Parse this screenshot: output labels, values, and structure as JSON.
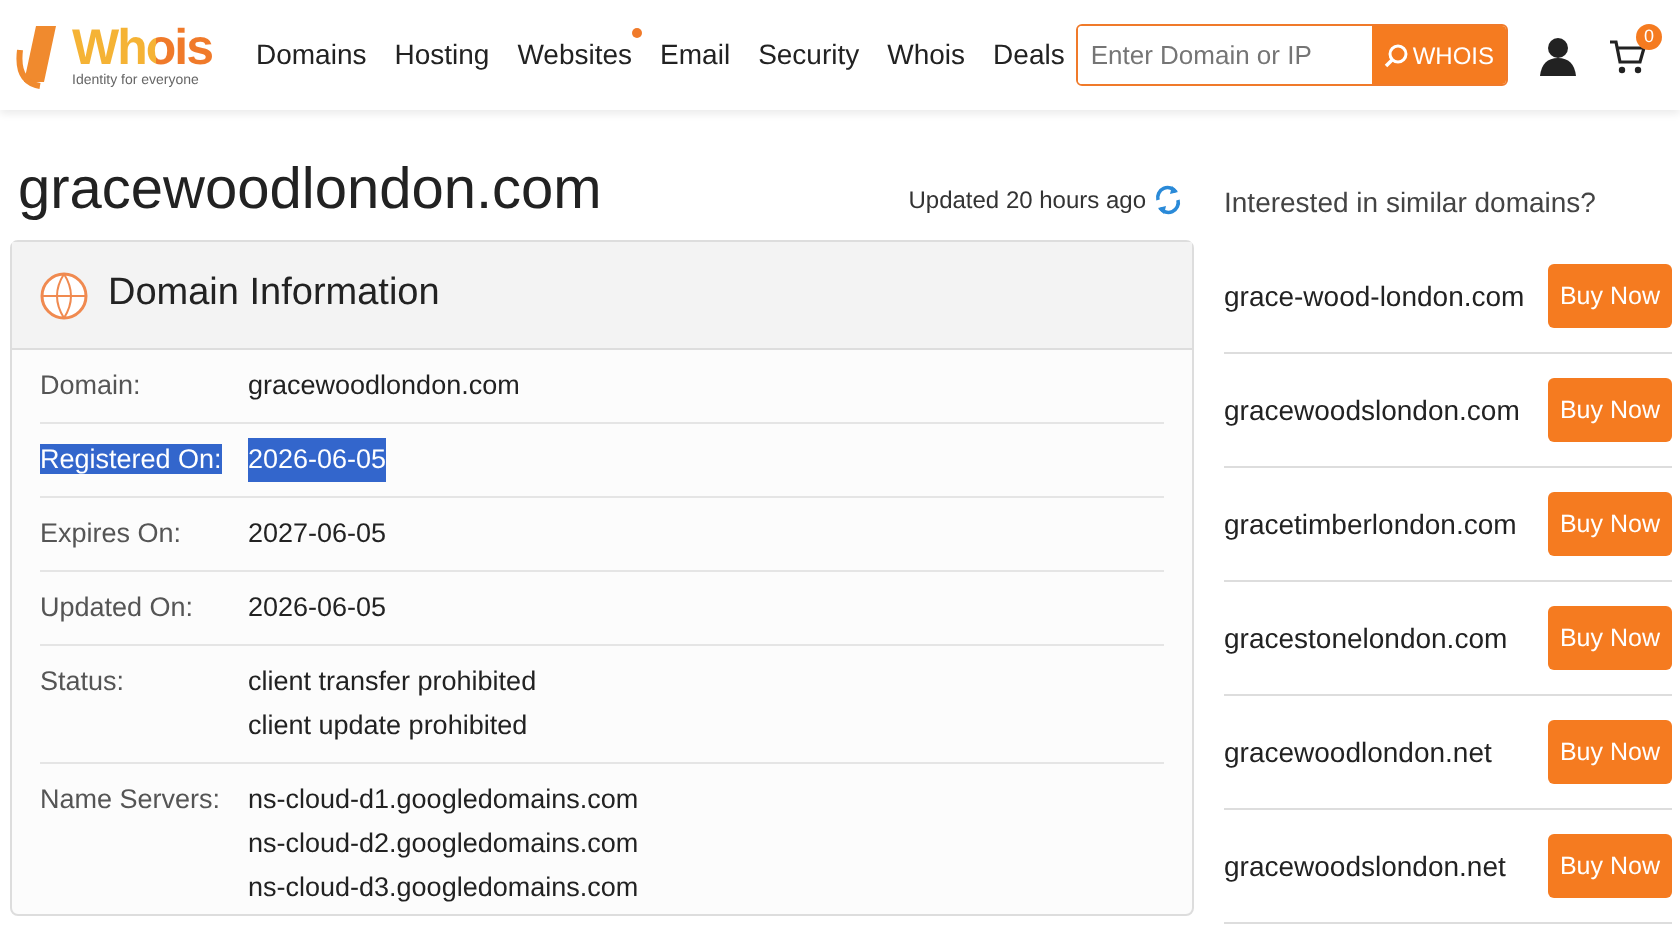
{
  "logo": {
    "name": "Whois",
    "tagline": "Identity for everyone"
  },
  "nav": [
    {
      "label": "Domains",
      "dot": false
    },
    {
      "label": "Hosting",
      "dot": false
    },
    {
      "label": "Websites",
      "dot": true
    },
    {
      "label": "Email",
      "dot": false
    },
    {
      "label": "Security",
      "dot": false
    },
    {
      "label": "Whois",
      "dot": false
    },
    {
      "label": "Deals",
      "dot": false
    }
  ],
  "search": {
    "placeholder": "Enter Domain or IP",
    "button": "WHOIS"
  },
  "cart_count": "0",
  "page_title": "gracewoodlondon.com",
  "updated": "Updated 20 hours ago",
  "card": {
    "title": "Domain Information",
    "rows": [
      {
        "label": "Domain:",
        "values": [
          "gracewoodlondon.com"
        ],
        "selected": false
      },
      {
        "label": "Registered On:",
        "values": [
          "2026-06-05"
        ],
        "selected": true
      },
      {
        "label": "Expires On:",
        "values": [
          "2027-06-05"
        ],
        "selected": false
      },
      {
        "label": "Updated On:",
        "values": [
          "2026-06-05"
        ],
        "selected": false
      },
      {
        "label": "Status:",
        "values": [
          "client transfer prohibited",
          "client update prohibited"
        ],
        "selected": false
      },
      {
        "label": "Name Servers:",
        "values": [
          "ns-cloud-d1.googledomains.com",
          "ns-cloud-d2.googledomains.com",
          "ns-cloud-d3.googledomains.com"
        ],
        "selected": false
      }
    ]
  },
  "similar": {
    "heading": "Interested in similar domains?",
    "items": [
      {
        "domain": "grace-wood-london.com",
        "button": "Buy Now"
      },
      {
        "domain": "gracewoodslondon.com",
        "button": "Buy Now"
      },
      {
        "domain": "gracetimberlondon.com",
        "button": "Buy Now"
      },
      {
        "domain": "gracestonelondon.com",
        "button": "Buy Now"
      },
      {
        "domain": "gracewoodlondon.net",
        "button": "Buy Now"
      },
      {
        "domain": "gracewoodslondon.net",
        "button": "Buy Now"
      }
    ]
  }
}
